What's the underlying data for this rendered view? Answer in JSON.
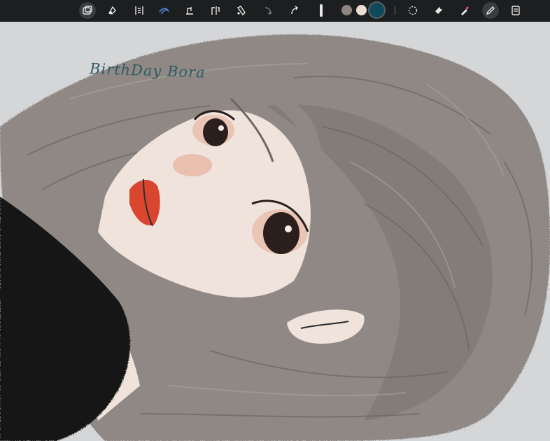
{
  "toolbar": {
    "tools": [
      {
        "name": "gallery-icon",
        "active": true
      },
      {
        "name": "adjust-icon",
        "active": false
      },
      {
        "name": "layers-adjust-icon",
        "active": false
      },
      {
        "name": "smudge-icon",
        "active": false
      },
      {
        "name": "transform-icon",
        "active": false
      },
      {
        "name": "flip-icon",
        "active": false
      },
      {
        "name": "ruler-icon",
        "active": false
      },
      {
        "name": "undo-icon",
        "active": false
      },
      {
        "name": "redo-icon",
        "active": false
      },
      {
        "name": "selection-icon",
        "active": false
      },
      {
        "name": "eraser-icon",
        "active": false
      },
      {
        "name": "eyedropper-icon",
        "active": false
      },
      {
        "name": "pencil-icon",
        "active": true
      },
      {
        "name": "layers-icon",
        "active": false
      }
    ],
    "colors": [
      "#8e8580",
      "#eddcd3",
      "#0f4a5c"
    ],
    "selected_color": "#0f4a5c",
    "accent": "#4d7fd6"
  },
  "canvas": {
    "annotation": "BirthDay Bora",
    "palette": {
      "background": "#d4d6d8",
      "hair": "#8f8884",
      "hair_dark": "#6d6663",
      "skin": "#efe3dc",
      "blush": "#e7b9a7",
      "lips": "#d9452e",
      "shirt": "#121212",
      "eye": "#2b1f1d"
    }
  }
}
